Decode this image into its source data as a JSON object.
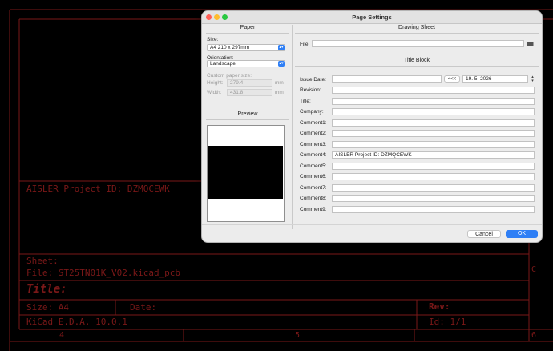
{
  "background": {
    "project_text": "AISLER Project ID: DZMQCEWK",
    "sheet_label": "Sheet:",
    "file_line": "File: ST25TN01K_V02.kicad_pcb",
    "title_label": "Title:",
    "size_label": "Size: A4",
    "date_label": "Date:",
    "rev_label": "Rev:",
    "kicad_line": "KiCad E.D.A. 10.0.1",
    "id_label": "Id: 1/1",
    "col4": "4",
    "col5": "5",
    "col6": "6",
    "row_c": "C"
  },
  "dialog": {
    "title": "Page Settings",
    "paper": {
      "header": "Paper",
      "size_label": "Size:",
      "size_value": "A4 210 x 297mm",
      "orientation_label": "Orientation:",
      "orientation_value": "Landscape",
      "custom_label": "Custom paper size:",
      "height_label": "Height:",
      "height_value": "279.4",
      "width_label": "Width:",
      "width_value": "431.8",
      "unit": "mm",
      "preview_header": "Preview"
    },
    "drawing_sheet": {
      "header": "Drawing Sheet",
      "file_label": "File:",
      "file_value": ""
    },
    "title_block": {
      "header": "Title Block",
      "issue_date_label": "Issue Date:",
      "issue_date_value": "",
      "copy_date_button": "<<<",
      "date_picker_value": "19.  5. 2026",
      "rows": [
        {
          "label": "Revision:",
          "value": ""
        },
        {
          "label": "Title:",
          "value": ""
        },
        {
          "label": "Company:",
          "value": ""
        },
        {
          "label": "Comment1:",
          "value": ""
        },
        {
          "label": "Comment2:",
          "value": ""
        },
        {
          "label": "Comment3:",
          "value": ""
        },
        {
          "label": "Comment4:",
          "value": "AISLER Project ID: DZMQCEWK"
        },
        {
          "label": "Comment5:",
          "value": ""
        },
        {
          "label": "Comment6:",
          "value": ""
        },
        {
          "label": "Comment7:",
          "value": ""
        },
        {
          "label": "Comment8:",
          "value": ""
        },
        {
          "label": "Comment9:",
          "value": ""
        }
      ]
    },
    "cancel_label": "Cancel",
    "ok_label": "OK"
  },
  "colors": {
    "accent": "#2f7ff5",
    "border_red": "#7a1818",
    "close": "#ff5f57",
    "minimize": "#febc2e",
    "zoom": "#28c840"
  }
}
